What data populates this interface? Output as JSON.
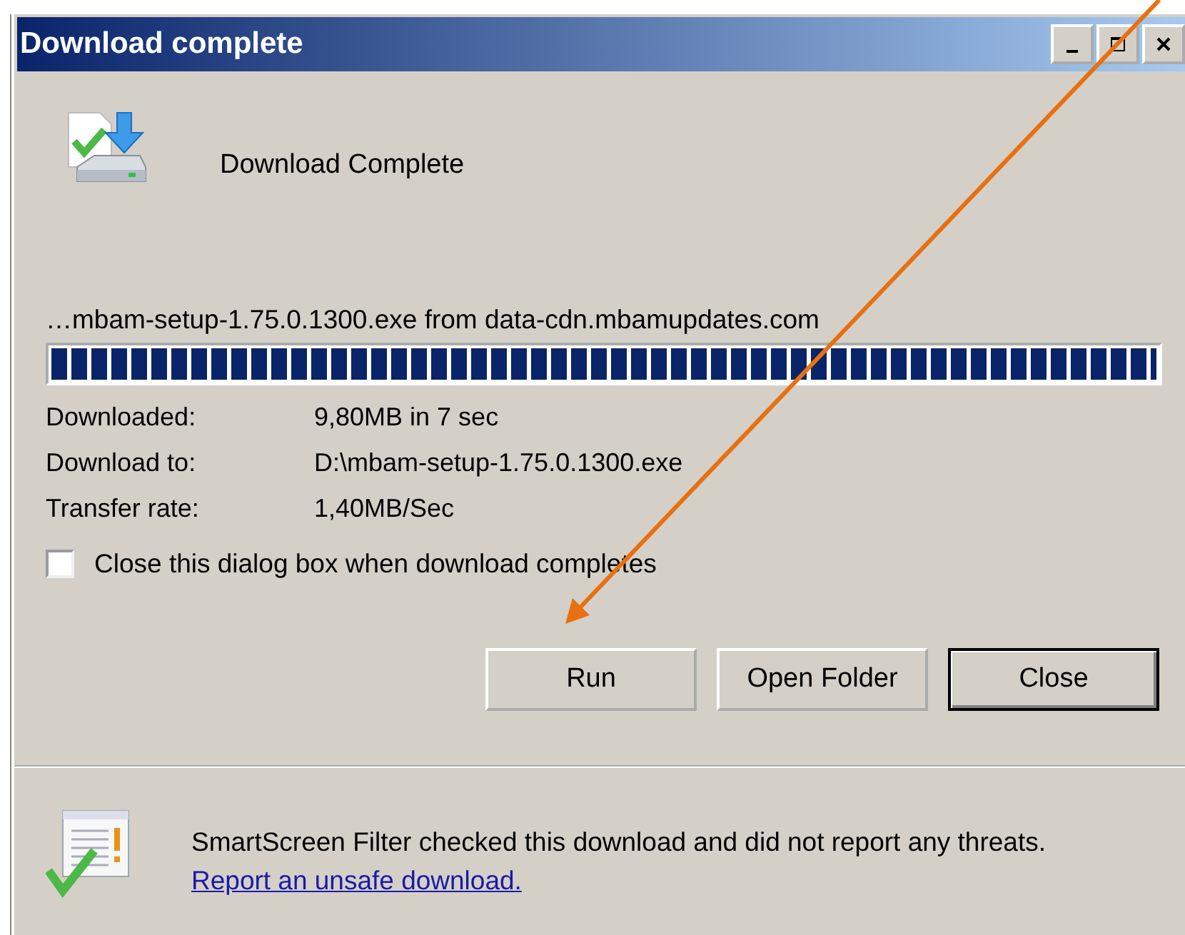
{
  "window": {
    "title": "Download complete"
  },
  "status": "Download Complete",
  "source": "…mbam-setup-1.75.0.1300.exe from data-cdn.mbamupdates.com",
  "progress": {
    "level": 1
  },
  "details": [
    {
      "label": "Downloaded:",
      "value": "9,80MB in 7 sec"
    },
    {
      "label": "Download to:",
      "value": "D:\\mbam-setup-1.75.0.1300.exe"
    },
    {
      "label": "Transfer rate:",
      "value": "1,40MB/Sec"
    }
  ],
  "close_when_done": {
    "label": "Close this dialog box when download completes",
    "checked": false
  },
  "buttons": [
    {
      "label": "Run",
      "default": false
    },
    {
      "label": "Open Folder",
      "default": false
    },
    {
      "label": "Close",
      "default": true
    }
  ],
  "smartscreen": {
    "text": "SmartScreen Filter checked this download and did not report any threats.",
    "link": "Report an unsafe download."
  }
}
